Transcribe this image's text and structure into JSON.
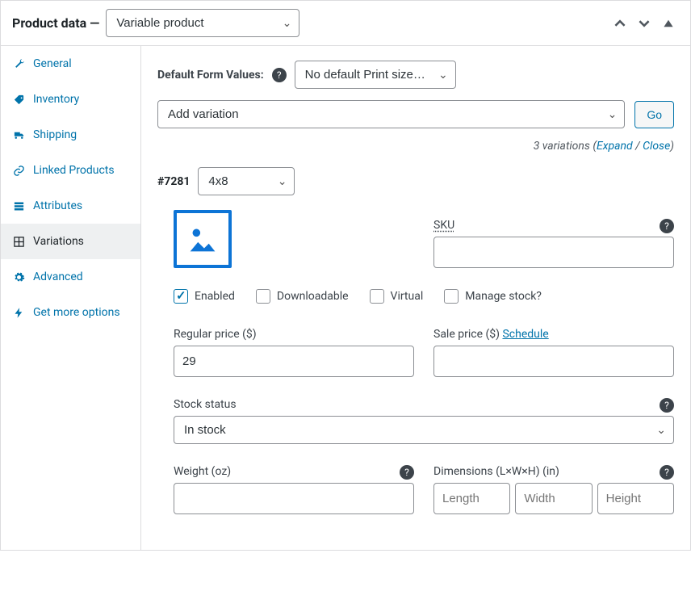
{
  "header": {
    "title": "Product data —",
    "product_type": "Variable product"
  },
  "tabs": [
    {
      "label": "General",
      "icon": "wrench"
    },
    {
      "label": "Inventory",
      "icon": "tag"
    },
    {
      "label": "Shipping",
      "icon": "truck"
    },
    {
      "label": "Linked Products",
      "icon": "link"
    },
    {
      "label": "Attributes",
      "icon": "list"
    },
    {
      "label": "Variations",
      "icon": "grid"
    },
    {
      "label": "Advanced",
      "icon": "gear"
    },
    {
      "label": "Get more options",
      "icon": "bolt"
    }
  ],
  "defaultForm": {
    "label": "Default Form Values:",
    "value": "No default Print size…"
  },
  "addVariation": {
    "label": "Add variation",
    "go": "Go"
  },
  "meta": {
    "count": "3 variations",
    "expand": "Expand",
    "sep": " / ",
    "close": "Close"
  },
  "variation": {
    "id": "#7281",
    "attribute": "4x8",
    "sku_label": "SKU",
    "checks": {
      "enabled": "Enabled",
      "downloadable": "Downloadable",
      "virtual": "Virtual",
      "manage_stock": "Manage stock?"
    },
    "regular_price_label": "Regular price ($)",
    "regular_price": "29",
    "sale_price_label": "Sale price ($) ",
    "sale_price_schedule": "Schedule",
    "stock_status_label": "Stock status",
    "stock_status": "In stock",
    "weight_label": "Weight (oz)",
    "dimensions_label": "Dimensions (L×W×H) (in)",
    "dim_ph": {
      "l": "Length",
      "w": "Width",
      "h": "Height"
    }
  }
}
